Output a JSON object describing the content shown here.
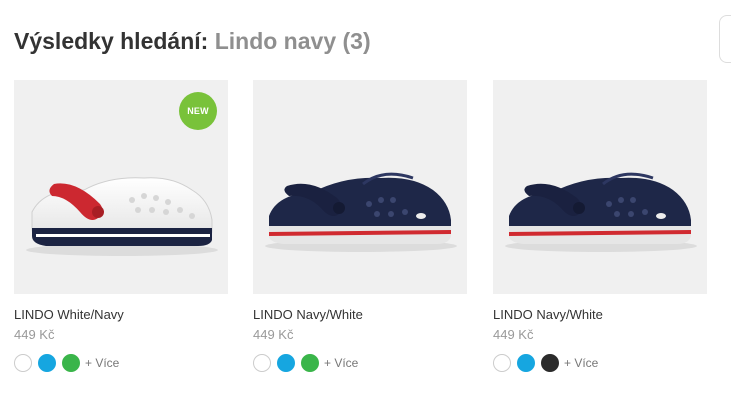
{
  "search": {
    "heading_label": "Výsledky hledání:",
    "query": "Lindo navy",
    "count": "(3)"
  },
  "products": [
    {
      "name": "LINDO White/Navy",
      "price": "449 Kč",
      "badge": "NEW",
      "shoe_colors": {
        "body": "#f6f6f6",
        "strap": "#cc2830",
        "stripe": "#1b2342"
      },
      "swatches": [
        "#ffffff",
        "#16a6e0",
        "#3ab54a"
      ],
      "more_label": "+ Více"
    },
    {
      "name": "LINDO Navy/White",
      "price": "449 Kč",
      "shoe_colors": {
        "body": "#1e2748",
        "strap": "#1e2748",
        "stripe": "#d02a30"
      },
      "swatches": [
        "#ffffff",
        "#16a6e0",
        "#3ab54a"
      ],
      "more_label": "+ Více"
    },
    {
      "name": "LINDO Navy/White",
      "price": "449 Kč",
      "shoe_colors": {
        "body": "#1e2748",
        "strap": "#1e2748",
        "stripe": "#d02a30"
      },
      "swatches": [
        "#ffffff",
        "#16a6e0",
        "#2b2b2b"
      ],
      "more_label": "+ Více"
    }
  ]
}
